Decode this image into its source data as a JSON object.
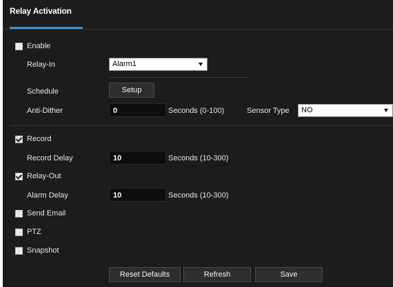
{
  "tab": {
    "title": "Relay Activation"
  },
  "enable": {
    "label": "Enable",
    "checked": false
  },
  "relay_in": {
    "label": "Relay-In",
    "value": "Alarm1"
  },
  "schedule": {
    "label": "Schedule",
    "button": "Setup"
  },
  "anti_dither": {
    "label": "Anti-Dither",
    "value": "0",
    "unit": "Seconds (0-100)"
  },
  "sensor_type": {
    "label": "Sensor Type",
    "value": "NO"
  },
  "record": {
    "label": "Record",
    "checked": true
  },
  "record_delay": {
    "label": "Record Delay",
    "value": "10",
    "unit": "Seconds (10-300)"
  },
  "relay_out": {
    "label": "Relay-Out",
    "checked": true
  },
  "alarm_delay": {
    "label": "Alarm Delay",
    "value": "10",
    "unit": "Seconds (10-300)"
  },
  "send_email": {
    "label": "Send Email",
    "checked": false
  },
  "ptz": {
    "label": "PTZ",
    "checked": false
  },
  "snapshot": {
    "label": "Snapshot",
    "checked": false
  },
  "actions": {
    "reset": "Reset Defaults",
    "refresh": "Refresh",
    "save": "Save"
  },
  "colors": {
    "accent": "#3a8fd6",
    "panel_bg": "#1c1c1c"
  }
}
